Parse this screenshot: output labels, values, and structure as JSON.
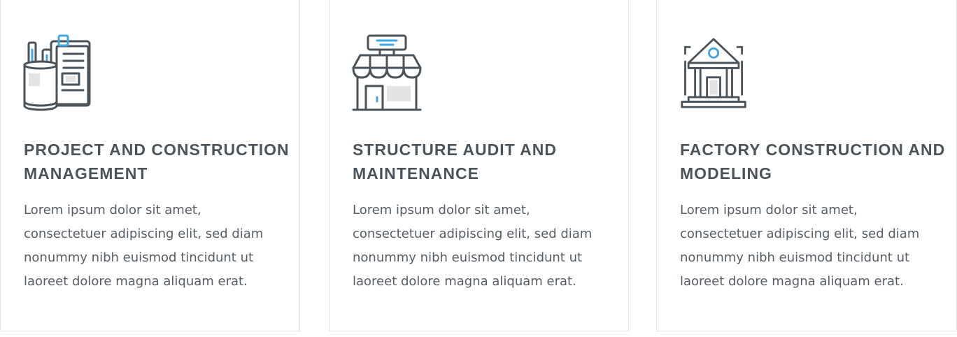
{
  "colors": {
    "icon_stroke": "#4a525a",
    "icon_accent": "#3fa7e0",
    "icon_fill": "#e3e3e3",
    "title": "#4c545b",
    "text": "#565e65",
    "card_border": "#e3e5e7"
  },
  "cards": [
    {
      "icon": "pencil-cup-document-icon",
      "title": "PROJECT AND CONSTRUCTION MANAGEMENT",
      "text": "Lorem ipsum dolor sit amet, consectetuer adipiscing elit, sed diam nonummy nibh euismod tincidunt ut laoreet dolore magna aliquam erat."
    },
    {
      "icon": "storefront-icon",
      "title": "STRUCTURE AUDIT AND MAINTENANCE",
      "text": "Lorem ipsum dolor sit amet, consectetuer adipiscing elit, sed diam nonummy nibh euismod tincidunt ut laoreet dolore magna aliquam erat."
    },
    {
      "icon": "classical-building-icon",
      "title": "FACTORY CONSTRUCTION AND MODELING",
      "text": "Lorem ipsum dolor sit amet, consectetuer adipiscing elit, sed diam nonummy nibh euismod tincidunt ut laoreet dolore magna aliquam erat."
    }
  ]
}
